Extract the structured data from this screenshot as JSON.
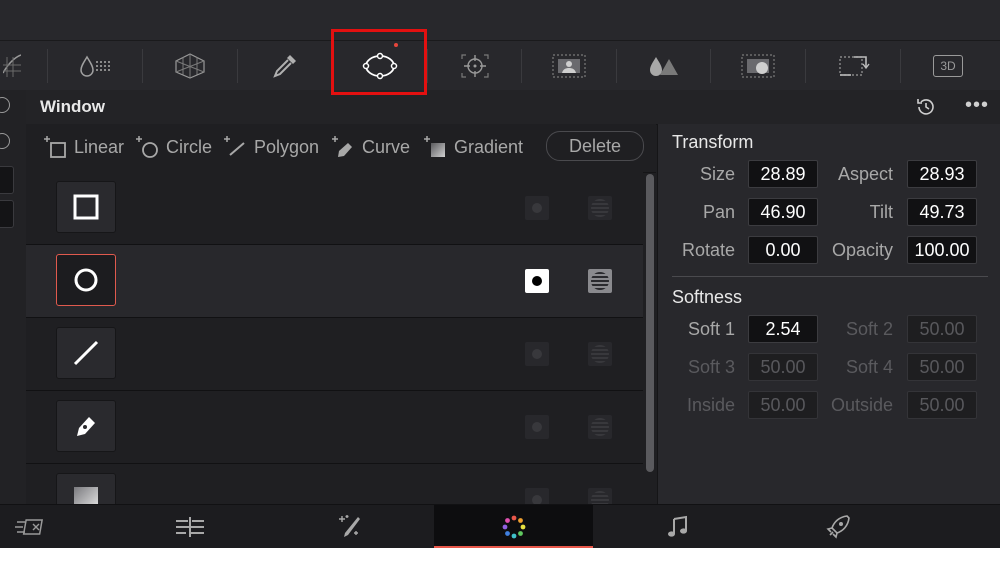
{
  "toolbar": {
    "tools": [
      {
        "name": "curves-tool-icon",
        "selected": false
      },
      {
        "name": "color-warper-icon",
        "selected": false
      },
      {
        "name": "hsl-qualifier-icon",
        "selected": false
      },
      {
        "name": "qualifier-eyedropper-icon",
        "selected": false
      },
      {
        "name": "window-tool-icon",
        "selected": true
      },
      {
        "name": "tracker-icon",
        "selected": false
      },
      {
        "name": "magic-mask-icon",
        "selected": false
      },
      {
        "name": "blur-icon",
        "selected": false
      },
      {
        "name": "key-icon",
        "selected": false
      },
      {
        "name": "sizing-icon",
        "selected": false
      },
      {
        "name": "3d-icon",
        "selected": false
      }
    ],
    "badge_3d": "3D"
  },
  "panel": {
    "title": "Window",
    "more_label": "•••"
  },
  "shape_buttons": {
    "linear": "Linear",
    "circle": "Circle",
    "polygon": "Polygon",
    "curve": "Curve",
    "gradient": "Gradient",
    "delete": "Delete"
  },
  "window_list": [
    {
      "shape": "square-window-icon",
      "selected": false,
      "enabled": false
    },
    {
      "shape": "circle-window-icon",
      "selected": true,
      "enabled": true
    },
    {
      "shape": "linear-window-icon",
      "selected": false,
      "enabled": false
    },
    {
      "shape": "curve-pen-window-icon",
      "selected": false,
      "enabled": false
    },
    {
      "shape": "gradient-window-icon",
      "selected": false,
      "enabled": false
    }
  ],
  "transform": {
    "title": "Transform",
    "size_label": "Size",
    "size": "28.89",
    "aspect_label": "Aspect",
    "aspect": "28.93",
    "pan_label": "Pan",
    "pan": "46.90",
    "tilt_label": "Tilt",
    "tilt": "49.73",
    "rotate_label": "Rotate",
    "rotate": "0.00",
    "opacity_label": "Opacity",
    "opacity": "100.00"
  },
  "softness": {
    "title": "Softness",
    "soft1_label": "Soft 1",
    "soft1": "2.54",
    "soft2_label": "Soft 2",
    "soft2": "50.00",
    "soft3_label": "Soft 3",
    "soft3": "50.00",
    "soft4_label": "Soft 4",
    "soft4": "50.00",
    "inside_label": "Inside",
    "inside": "50.00",
    "outside_label": "Outside",
    "outside": "50.00"
  },
  "bottom_tabs": [
    {
      "name": "cut-page-icon",
      "active": false
    },
    {
      "name": "edit-page-icon",
      "active": false
    },
    {
      "name": "fusion-page-icon",
      "active": false
    },
    {
      "name": "color-page-icon",
      "active": true
    },
    {
      "name": "fairlight-page-icon",
      "active": false
    },
    {
      "name": "deliver-page-icon",
      "active": false
    }
  ],
  "colors": {
    "accent_red": "#e8574a",
    "highlight_box": "#e31010",
    "panel_bg": "#28282c"
  }
}
